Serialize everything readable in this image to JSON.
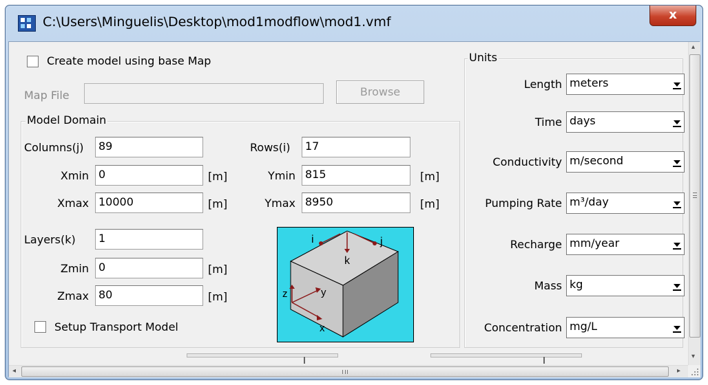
{
  "window": {
    "title": "C:\\Users\\Minguelis\\Desktop\\mod1modflow\\mod1.vmf",
    "close_label": "x"
  },
  "base_map": {
    "create_label": "Create model using base Map",
    "map_file_label": "Map File",
    "map_file_value": "",
    "browse_label": "Browse"
  },
  "model_domain": {
    "title": "Model Domain",
    "columns_label": "Columns(j)",
    "columns_value": "89",
    "rows_label": "Rows(i)",
    "rows_value": "17",
    "xmin_label": "Xmin",
    "xmin_value": "0",
    "xmax_label": "Xmax",
    "xmax_value": "10000",
    "ymin_label": "Ymin",
    "ymin_value": "815",
    "ymax_label": "Ymax",
    "ymax_value": "8950",
    "layers_label": "Layers(k)",
    "layers_value": "1",
    "zmin_label": "Zmin",
    "zmin_value": "0",
    "zmax_label": "Zmax",
    "zmax_value": "80",
    "unit_m": "[m]",
    "transport_label": "Setup Transport Model",
    "diagram_labels": {
      "i": "i",
      "j": "j",
      "k": "k",
      "x": "x",
      "y": "y",
      "z": "z"
    },
    "diagram_colors": {
      "background": "#35d6e8",
      "cube_top": "#d4d4d4",
      "cube_front": "#c4c4c4",
      "cube_side": "#8c8c8c",
      "arrow": "#8b1a1a"
    }
  },
  "units": {
    "title": "Units",
    "rows": [
      {
        "label": "Length",
        "value": "meters"
      },
      {
        "label": "Time",
        "value": "days"
      },
      {
        "label": "Conductivity",
        "value": "m/second"
      },
      {
        "label": "Pumping Rate",
        "value": "m³/day"
      },
      {
        "label": "Recharge",
        "value": "mm/year"
      },
      {
        "label": "Mass",
        "value": "kg"
      },
      {
        "label": "Concentration",
        "value": "mg/L"
      }
    ]
  },
  "scrollbars": {
    "h_left_arrow": "◂",
    "h_right_arrow": "▸",
    "v_up_arrow": "▴",
    "v_down_arrow": "▾"
  }
}
